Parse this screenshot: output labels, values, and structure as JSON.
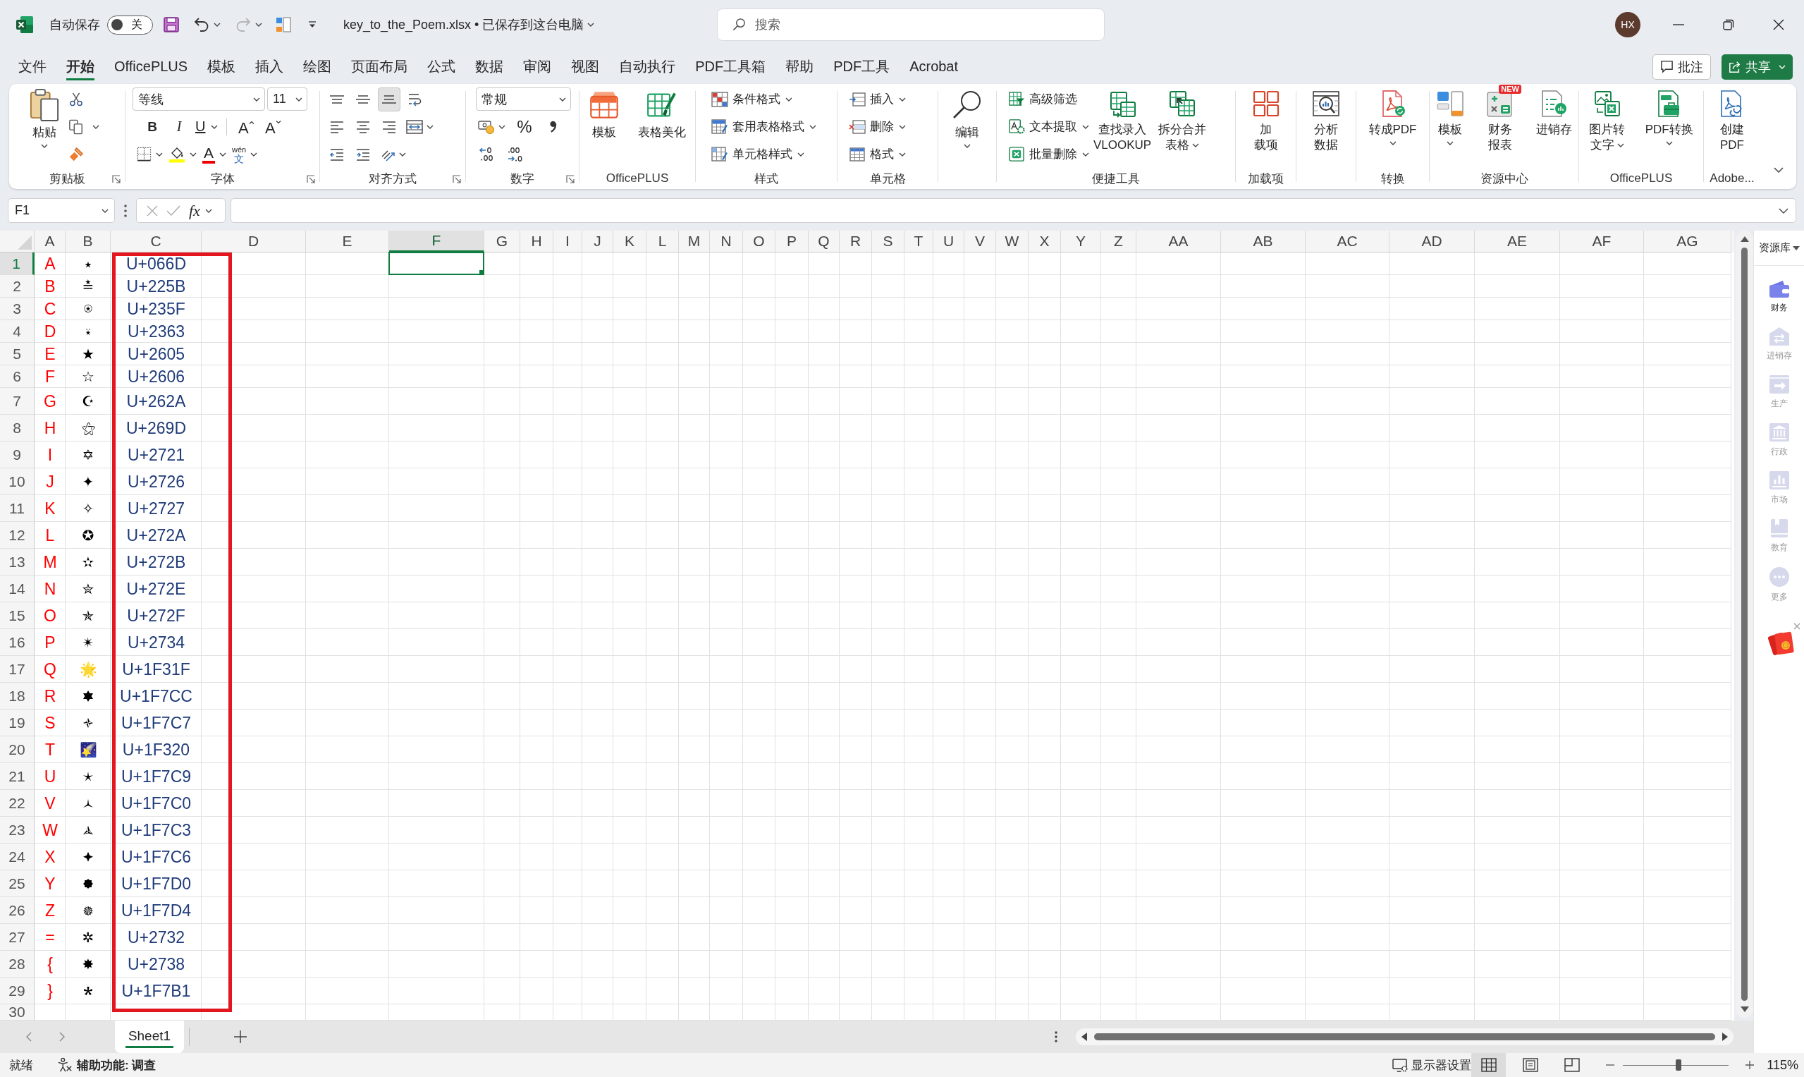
{
  "title_bar": {
    "autosave_label": "自动保存",
    "autosave_toggle": {
      "on": false,
      "label": "关"
    },
    "redo": {
      "disabled": true
    },
    "document_title": "key_to_the_Poem.xlsx • 已保存到这台电脑",
    "search": {
      "placeholder": "搜索"
    },
    "avatar_initials": "HX"
  },
  "menu_tabs": [
    {
      "label": "文件",
      "selected": false
    },
    {
      "label": "开始",
      "selected": true
    },
    {
      "label": "OfficePLUS",
      "selected": false
    },
    {
      "label": "模板",
      "selected": false
    },
    {
      "label": "插入",
      "selected": false
    },
    {
      "label": "绘图",
      "selected": false
    },
    {
      "label": "页面布局",
      "selected": false
    },
    {
      "label": "公式",
      "selected": false
    },
    {
      "label": "数据",
      "selected": false
    },
    {
      "label": "审阅",
      "selected": false
    },
    {
      "label": "视图",
      "selected": false
    },
    {
      "label": "自动执行",
      "selected": false
    },
    {
      "label": "PDF工具箱",
      "selected": false
    },
    {
      "label": "帮助",
      "selected": false
    },
    {
      "label": "PDF工具",
      "selected": false
    },
    {
      "label": "Acrobat",
      "selected": false
    }
  ],
  "menu_buttons": {
    "comment": "批注",
    "share": "共享"
  },
  "ribbon": {
    "clipboard": {
      "label": "剪贴板",
      "paste": "粘贴"
    },
    "font": {
      "label": "字体",
      "font_name": "等线",
      "font_size": "11",
      "bold": "B",
      "italic": "I",
      "underline": "U",
      "grow": "A",
      "shrink": "A",
      "font_color": "A",
      "phonetic_reading": "wén",
      "phonetic_character": "文"
    },
    "alignment": {
      "label": "对齐方式",
      "vertical": [
        {
          "selected": false
        },
        {
          "selected": false
        },
        {
          "selected": true
        }
      ]
    },
    "number": {
      "label": "数字",
      "format": "常规",
      "percent": "%"
    },
    "officeplus": {
      "label": "OfficePLUS",
      "buttons": [
        "模板",
        "表格美化"
      ]
    },
    "styles": {
      "label": "样式",
      "buttons": [
        "条件格式",
        "套用表格格式",
        "单元格样式"
      ]
    },
    "cells": {
      "label": "单元格",
      "buttons": [
        "插入",
        "删除",
        "格式"
      ]
    },
    "editing": {
      "button": "编辑"
    },
    "quick_tools": {
      "label": "便捷工具",
      "small_buttons": [
        "高级筛选",
        "文本提取",
        "批量删除"
      ],
      "lookup": [
        "查找录入",
        "VLOOKUP"
      ],
      "split_merge": [
        "拆分合并",
        "表格"
      ]
    },
    "addins": {
      "label": "加载项",
      "button": [
        "加",
        "载项"
      ]
    },
    "analysis": {
      "button": [
        "分析",
        "数据"
      ]
    },
    "convert": {
      "label": "转换",
      "button": "转成PDF"
    },
    "resource_center": {
      "label": "资源中心",
      "buttons": [
        {
          "lines": [
            "模板"
          ]
        },
        {
          "lines": [
            "财务",
            "报表"
          ],
          "badge": "NEW"
        },
        {
          "lines": [
            "进销存"
          ]
        }
      ]
    },
    "officeplus_tools": {
      "label": "OfficePLUS",
      "buttons": [
        [
          "图片转",
          "文字"
        ],
        [
          "PDF转换"
        ]
      ]
    },
    "adobe": {
      "label": "Adobe...",
      "button": [
        "创建",
        "PDF"
      ]
    }
  },
  "formula_bar": {
    "name_box": "F1",
    "function_label": "fx"
  },
  "sheet": {
    "columns": [
      {
        "label": "A",
        "selected": false
      },
      {
        "label": "B",
        "selected": false
      },
      {
        "label": "C",
        "selected": false
      },
      {
        "label": "D",
        "selected": false
      },
      {
        "label": "E",
        "selected": false
      },
      {
        "label": "F",
        "selected": true
      },
      {
        "label": "G",
        "selected": false
      },
      {
        "label": "H",
        "selected": false
      },
      {
        "label": "I",
        "selected": false
      },
      {
        "label": "J",
        "selected": false
      },
      {
        "label": "K",
        "selected": false
      },
      {
        "label": "L",
        "selected": false
      },
      {
        "label": "M",
        "selected": false
      },
      {
        "label": "N",
        "selected": false
      },
      {
        "label": "O",
        "selected": false
      },
      {
        "label": "P",
        "selected": false
      },
      {
        "label": "Q",
        "selected": false
      },
      {
        "label": "R",
        "selected": false
      },
      {
        "label": "S",
        "selected": false
      },
      {
        "label": "T",
        "selected": false
      },
      {
        "label": "U",
        "selected": false
      },
      {
        "label": "V",
        "selected": false
      },
      {
        "label": "W",
        "selected": false
      },
      {
        "label": "X",
        "selected": false
      },
      {
        "label": "Y",
        "selected": false
      },
      {
        "label": "Z",
        "selected": false
      },
      {
        "label": "AA",
        "selected": false
      },
      {
        "label": "AB",
        "selected": false
      },
      {
        "label": "AC",
        "selected": false
      },
      {
        "label": "AD",
        "selected": false
      },
      {
        "label": "AE",
        "selected": false
      },
      {
        "label": "AF",
        "selected": false
      },
      {
        "label": "AG",
        "selected": false
      }
    ],
    "rows": [
      {
        "number": "1",
        "selected": true,
        "cells": [
          "A",
          "٭",
          "U+066D"
        ]
      },
      {
        "number": "2",
        "selected": false,
        "cells": [
          "B",
          "≛",
          "U+225B"
        ]
      },
      {
        "number": "3",
        "selected": false,
        "cells": [
          "C",
          "⍟",
          "U+235F"
        ]
      },
      {
        "number": "4",
        "selected": false,
        "cells": [
          "D",
          "⍣",
          "U+2363"
        ]
      },
      {
        "number": "5",
        "selected": false,
        "cells": [
          "E",
          "★",
          "U+2605"
        ]
      },
      {
        "number": "6",
        "selected": false,
        "cells": [
          "F",
          "☆",
          "U+2606"
        ]
      },
      {
        "number": "7",
        "selected": false,
        "cells": [
          "G",
          "☪",
          "U+262A"
        ]
      },
      {
        "number": "8",
        "selected": false,
        "cells": [
          "H",
          "⚝",
          "U+269D"
        ]
      },
      {
        "number": "9",
        "selected": false,
        "cells": [
          "I",
          "✡",
          "U+2721"
        ]
      },
      {
        "number": "10",
        "selected": false,
        "cells": [
          "J",
          "✦",
          "U+2726"
        ]
      },
      {
        "number": "11",
        "selected": false,
        "cells": [
          "K",
          "✧",
          "U+2727"
        ]
      },
      {
        "number": "12",
        "selected": false,
        "cells": [
          "L",
          "✪",
          "U+272A"
        ]
      },
      {
        "number": "13",
        "selected": false,
        "cells": [
          "M",
          "✫",
          "U+272B"
        ]
      },
      {
        "number": "14",
        "selected": false,
        "cells": [
          "N",
          "✮",
          "U+272E"
        ]
      },
      {
        "number": "15",
        "selected": false,
        "cells": [
          "O",
          "✯",
          "U+272F"
        ]
      },
      {
        "number": "16",
        "selected": false,
        "cells": [
          "P",
          "✴",
          "U+2734"
        ]
      },
      {
        "number": "17",
        "selected": false,
        "cells": [
          "Q",
          "🌟",
          "U+1F31F"
        ]
      },
      {
        "number": "18",
        "selected": false,
        "cells": [
          "R",
          "🟌",
          "U+1F7CC"
        ]
      },
      {
        "number": "19",
        "selected": false,
        "cells": [
          "S",
          "🟇",
          "U+1F7C7"
        ]
      },
      {
        "number": "20",
        "selected": false,
        "cells": [
          "T",
          "🌠",
          "U+1F320"
        ]
      },
      {
        "number": "21",
        "selected": false,
        "cells": [
          "U",
          "🟉",
          "U+1F7C9"
        ]
      },
      {
        "number": "22",
        "selected": false,
        "cells": [
          "V",
          "🟀",
          "U+1F7C0"
        ]
      },
      {
        "number": "23",
        "selected": false,
        "cells": [
          "W",
          "🟃",
          "U+1F7C3"
        ]
      },
      {
        "number": "24",
        "selected": false,
        "cells": [
          "X",
          "🟆",
          "U+1F7C6"
        ]
      },
      {
        "number": "25",
        "selected": false,
        "cells": [
          "Y",
          "🟐",
          "U+1F7D0"
        ]
      },
      {
        "number": "26",
        "selected": false,
        "cells": [
          "Z",
          "🟔",
          "U+1F7D4"
        ]
      },
      {
        "number": "27",
        "selected": false,
        "cells": [
          "=",
          "✲",
          "U+2732"
        ]
      },
      {
        "number": "28",
        "selected": false,
        "cells": [
          "{",
          "✸",
          "U+2738"
        ]
      },
      {
        "number": "29",
        "selected": false,
        "cells": [
          "}",
          "🞱",
          "U+1F7B1"
        ]
      },
      {
        "number": "30",
        "selected": false
      }
    ]
  },
  "sheet_tabs": [
    {
      "label": "Sheet1",
      "selected": true
    }
  ],
  "side_panel": {
    "title": "资源库",
    "items": [
      {
        "label": "财务",
        "selected": true
      },
      {
        "label": "进销存",
        "selected": false
      },
      {
        "label": "生产",
        "selected": false
      },
      {
        "label": "行政",
        "selected": false
      },
      {
        "label": "市场",
        "selected": false
      },
      {
        "label": "教育",
        "selected": false
      },
      {
        "label": "更多",
        "selected": false
      }
    ]
  },
  "status_bar": {
    "ready": "就绪",
    "accessibility": "辅助功能: 调查",
    "display_settings": "显示器设置",
    "views": [
      {
        "selected": true
      },
      {
        "selected": false
      },
      {
        "selected": false
      }
    ],
    "zoom": {
      "level": 0.525,
      "percent": "115%"
    }
  }
}
